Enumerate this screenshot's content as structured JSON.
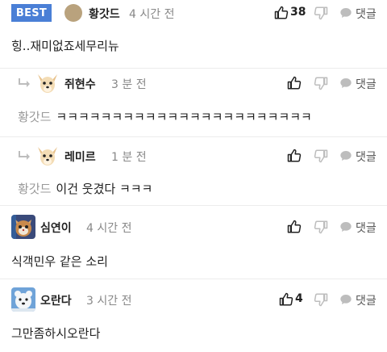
{
  "colors": {
    "badge": "#4a7fd6",
    "muted": "#888888",
    "icon": "#bdbdbd"
  },
  "comments": [
    {
      "badge": "BEST",
      "avatar": "brown-dot-avatar",
      "author": "황갓드",
      "time": "4 시간 전",
      "likes": "38",
      "dislikes": "",
      "reply_label": "댓글",
      "text": "힝..재미없죠세무리뉴"
    },
    {
      "avatar": "chihuahua-avatar",
      "author": "쥐현수",
      "time": "3 분 전",
      "likes": "",
      "dislikes": "",
      "reply_label": "댓글",
      "mention": "황갓드",
      "text": "ㅋㅋㅋㅋㅋㅋㅋㅋㅋㅋㅋㅋㅋㅋㅋㅋㅋㅋㅋㅋㅋㅋㅋ"
    },
    {
      "avatar": "chihuahua-avatar",
      "author": "레미르",
      "time": "1 분 전",
      "likes": "",
      "dislikes": "",
      "reply_label": "댓글",
      "mention": "황갓드",
      "text": "이건 웃겼다 ㅋㅋㅋ"
    },
    {
      "avatar": "cat-avatar",
      "author": "심연이",
      "time": "4 시간 전",
      "likes": "",
      "dislikes": "",
      "reply_label": "댓글",
      "text": "식객민우 같은 소리"
    },
    {
      "avatar": "polar-bear-avatar",
      "author": "오란다",
      "time": "3 시간 전",
      "likes": "4",
      "dislikes": "",
      "reply_label": "댓글",
      "text": "그만좀하시오란다"
    }
  ]
}
